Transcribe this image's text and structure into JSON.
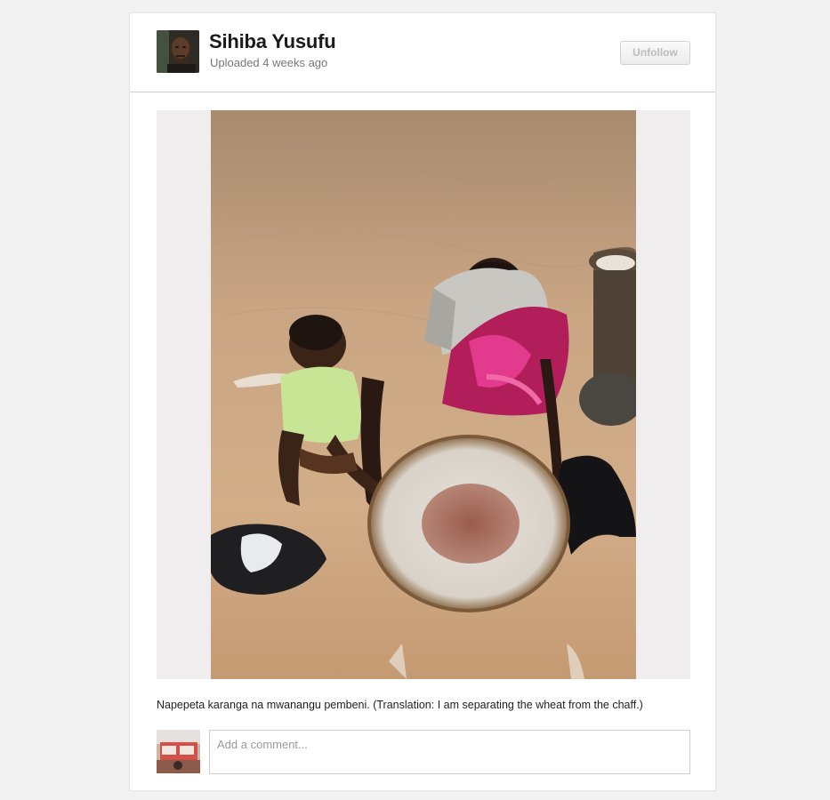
{
  "post": {
    "author_name": "Sihiba Yusufu",
    "uploaded_text": "Uploaded 4 weeks ago",
    "unfollow_label": "Unfollow",
    "caption": "Napepeta karanga na mwanangu pembeni. (Translation: I am separating the wheat from the chaff.)"
  },
  "comment": {
    "placeholder": "Add a comment..."
  },
  "icons": {
    "author_avatar": "user-avatar",
    "commenter_avatar": "user-avatar"
  },
  "colors": {
    "page_background": "#f3f2f3",
    "card_background": "#ffffff",
    "divider": "#cfcfcf",
    "name_text": "#1b1b1b",
    "muted_text": "#777777"
  }
}
